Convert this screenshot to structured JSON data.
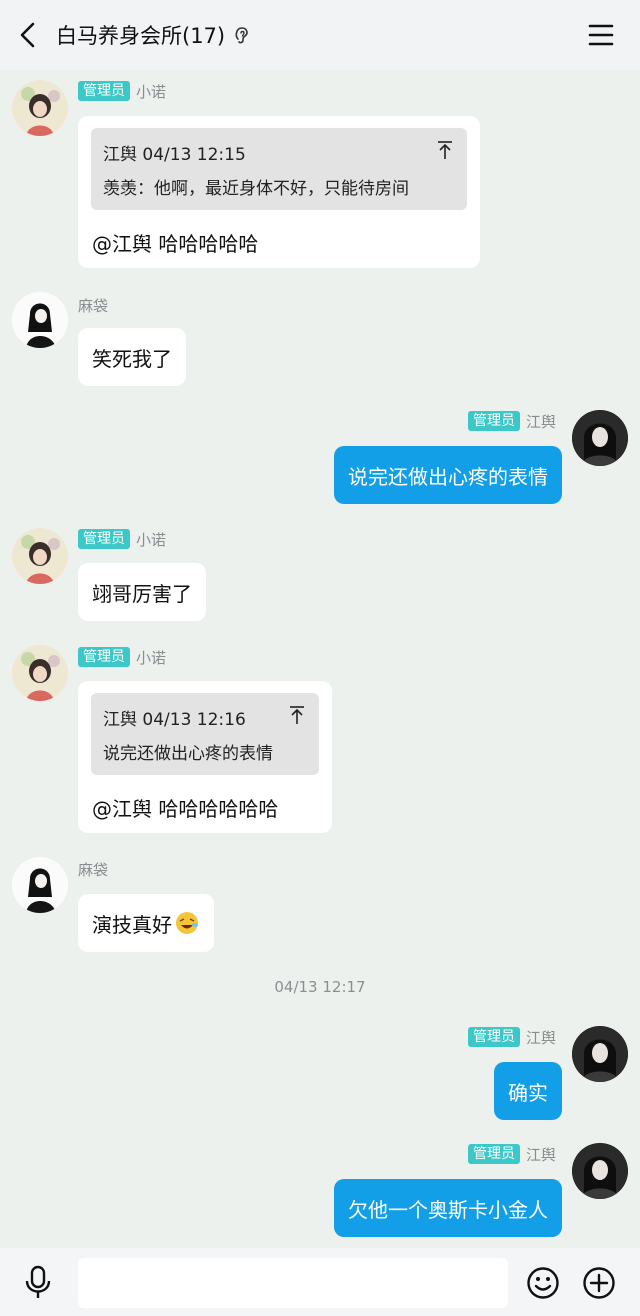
{
  "header": {
    "title": "白马养身会所(17)",
    "back_icon": "chevron-left-icon",
    "ear_icon": "ear-icon",
    "menu_icon": "hamburger-menu-icon"
  },
  "colors": {
    "background": "#edf1ee",
    "admin_badge": "#3cc8c8",
    "my_bubble": "#139ee8"
  },
  "messages": [
    {
      "sender": "小诺",
      "badge": "管理员",
      "quote": {
        "header": "江舆 04/13 12:15",
        "text": "羡羡：他啊，最近身体不好，只能待房间"
      },
      "text": "@江舆 哈哈哈哈哈"
    },
    {
      "sender": "麻袋",
      "text": "笑死我了"
    },
    {
      "sender": "江舆",
      "badge": "管理员",
      "text": "说完还做出心疼的表情"
    },
    {
      "sender": "小诺",
      "badge": "管理员",
      "text": "翊哥厉害了"
    },
    {
      "sender": "小诺",
      "badge": "管理员",
      "quote": {
        "header": "江舆 04/13 12:16",
        "text": "说完还做出心疼的表情"
      },
      "text": "@江舆 哈哈哈哈哈哈"
    },
    {
      "sender": "麻袋",
      "text": "演技真好"
    },
    {
      "sender": "江舆",
      "badge": "管理员",
      "text": "确实"
    },
    {
      "sender": "江舆",
      "badge": "管理员",
      "text": "欠他一个奥斯卡小金人"
    }
  ],
  "timestamp": "04/13 12:17",
  "input": {
    "placeholder": "",
    "value": ""
  },
  "bottom_icons": [
    "microphone-icon",
    "emoji-icon",
    "plus-icon"
  ]
}
